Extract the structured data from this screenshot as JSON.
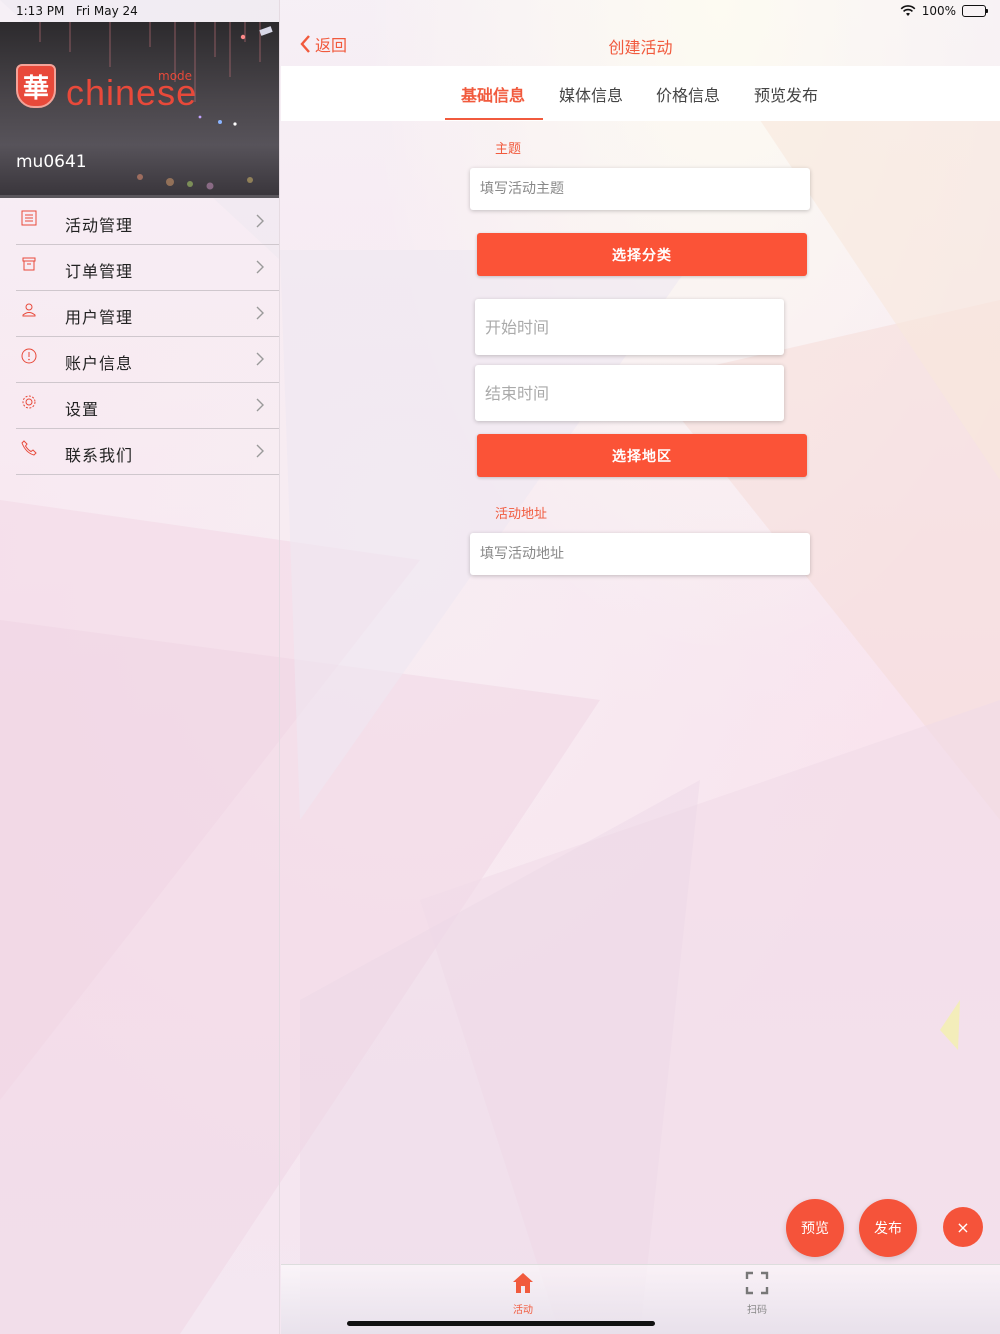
{
  "status_bar": {
    "time": "1:13 PM",
    "date": "Fri May 24",
    "battery": "100%"
  },
  "sidebar": {
    "logo_char": "華",
    "logo_text": "chinese",
    "logo_sub": "mode",
    "username": "mu0641",
    "items": [
      {
        "label": "活动管理",
        "icon": "list-icon"
      },
      {
        "label": "订单管理",
        "icon": "archive-icon"
      },
      {
        "label": "用户管理",
        "icon": "user-icon"
      },
      {
        "label": "账户信息",
        "icon": "info-icon"
      },
      {
        "label": "设置",
        "icon": "gear-icon"
      },
      {
        "label": "联系我们",
        "icon": "phone-icon"
      }
    ]
  },
  "nav": {
    "back_label": "返回",
    "title": "创建活动"
  },
  "tabs": [
    {
      "label": "基础信息",
      "active": true
    },
    {
      "label": "媒体信息",
      "active": false
    },
    {
      "label": "价格信息",
      "active": false
    },
    {
      "label": "预览发布",
      "active": false
    }
  ],
  "form": {
    "theme_label": "主题",
    "theme_placeholder": "填写活动主题",
    "category_button": "选择分类",
    "start_time_placeholder": "开始时间",
    "end_time_placeholder": "结束时间",
    "region_button": "选择地区",
    "address_label": "活动地址",
    "address_placeholder": "填写活动地址"
  },
  "fabs": {
    "preview": "预览",
    "publish": "发布",
    "close": "×"
  },
  "tabbar": {
    "activity": "活动",
    "scan": "扫码"
  },
  "colors": {
    "accent": "#f15a3d",
    "button": "#fb5337"
  }
}
